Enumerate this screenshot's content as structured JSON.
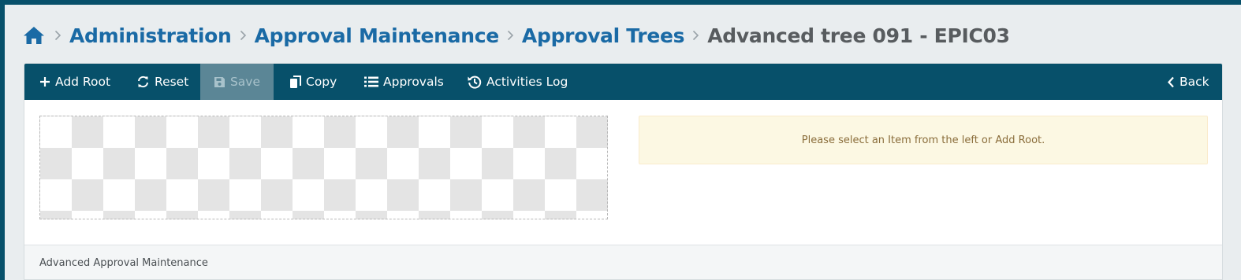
{
  "breadcrumb": {
    "home_icon": "home-icon",
    "items": [
      "Administration",
      "Approval Maintenance",
      "Approval Trees"
    ],
    "current": "Advanced tree 091 - EPIC03"
  },
  "toolbar": {
    "add_root": "Add Root",
    "reset": "Reset",
    "save": "Save",
    "copy": "Copy",
    "approvals": "Approvals",
    "activities_log": "Activities Log",
    "back": "Back"
  },
  "alert": {
    "message": "Please select an Item from the left or Add Root."
  },
  "footer": {
    "text": "Advanced Approval Maintenance"
  },
  "colors": {
    "header_bg": "#07506a",
    "link": "#1a6aa5",
    "alert_bg": "#fcf8e3",
    "alert_text": "#8a6d3b"
  }
}
